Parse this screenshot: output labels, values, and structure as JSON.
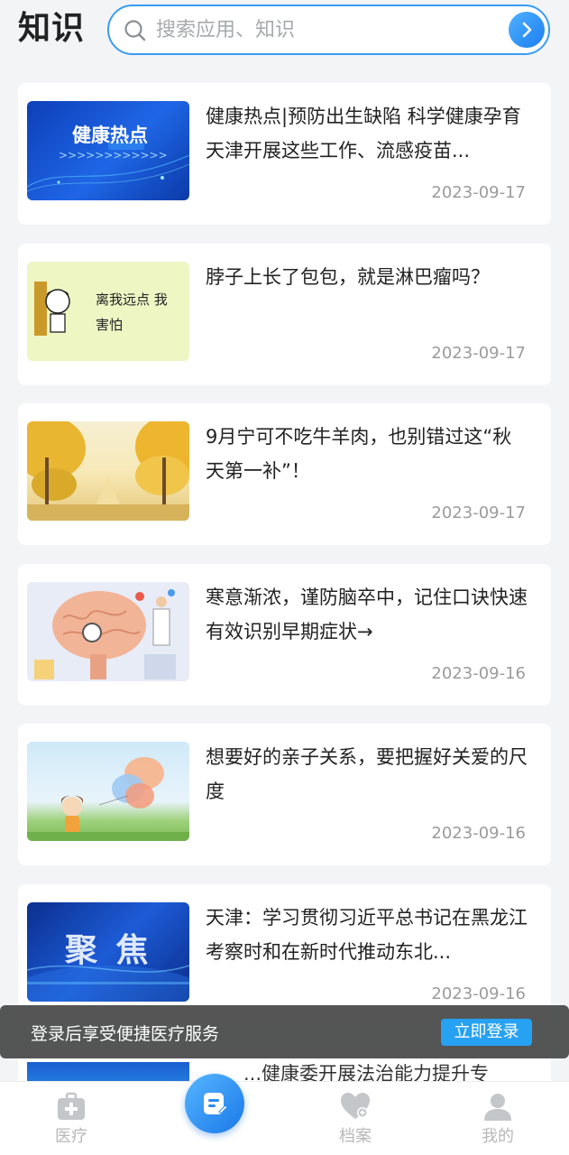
{
  "header": {
    "title": "知识",
    "search_placeholder": "搜索应用、知识"
  },
  "articles": [
    {
      "title": "健康热点|预防出生缺陷 科学健康孕育 天津开展这些工作、流感疫苗...",
      "date": "2023-09-17",
      "thumb_text": "健康热点",
      "thumb_icon": "health-hotspot-banner"
    },
    {
      "title": "脖子上长了包包，就是淋巴瘤吗？",
      "date": "2023-09-17",
      "thumb_text": "离我远点 我害怕",
      "thumb_icon": "meme-image"
    },
    {
      "title": "9月宁可不吃牛羊肉，也别错过这“秋天第一补”！",
      "date": "2023-09-17",
      "thumb_icon": "autumn-trees-image"
    },
    {
      "title": "寒意渐浓，谨防脑卒中，记住口诀快速有效识别早期症状→",
      "date": "2023-09-16",
      "thumb_icon": "brain-illustration"
    },
    {
      "title": "想要好的亲子关系，要把握好关爱的尺度",
      "date": "2023-09-16",
      "thumb_icon": "child-balloon-illustration"
    },
    {
      "title": "天津：学习贯彻习近平总书记在黑龙江考察时和在新时代推动东北...",
      "date": "2023-09-16",
      "thumb_text": "聚 焦",
      "thumb_icon": "focus-banner"
    }
  ],
  "partial_article": {
    "title": "...健康委开展法治能力提升专"
  },
  "toast": {
    "text": "登录后享受便捷医疗服务",
    "button": "立即登录"
  },
  "tabbar": {
    "items": [
      {
        "label": "医疗",
        "icon": "medical-kit-icon"
      },
      {
        "label": "",
        "icon": "note-edit-icon"
      },
      {
        "label": "档案",
        "icon": "heart-file-icon"
      },
      {
        "label": "我的",
        "icon": "user-icon"
      }
    ]
  },
  "colors": {
    "accent": "#27a1f2",
    "search_border": "#3a9cf0",
    "date_gray": "#9b9b9b"
  }
}
